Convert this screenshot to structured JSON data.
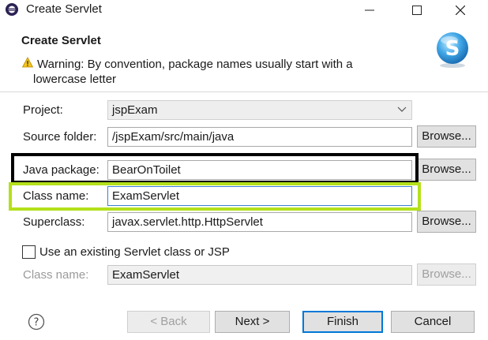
{
  "window": {
    "title": "Create Servlet"
  },
  "banner": {
    "title": "Create Servlet",
    "warning_line1": "Warning: By convention, package names usually start with a",
    "warning_line2": "lowercase letter"
  },
  "form": {
    "project": {
      "label": "Project:",
      "value": "jspExam"
    },
    "source_folder": {
      "label": "Source folder:",
      "value": "/jspExam/src/main/java",
      "browse": "Browse..."
    },
    "java_package": {
      "label": "Java package:",
      "value": "BearOnToilet",
      "browse": "Browse..."
    },
    "class_name": {
      "label": "Class name:",
      "value": "ExamServlet"
    },
    "superclass": {
      "label": "Superclass:",
      "value": "javax.servlet.http.HttpServlet",
      "browse": "Browse..."
    },
    "existing": {
      "label": "Use an existing Servlet class or JSP",
      "checked": false
    },
    "existing_class_name": {
      "label": "Class name:",
      "value": "ExamServlet",
      "browse": "Browse..."
    }
  },
  "buttons": {
    "back": "< Back",
    "next": "Next >",
    "finish": "Finish",
    "cancel": "Cancel"
  },
  "colors": {
    "highlight_black": "#000000",
    "highlight_green": "#b4e01c",
    "default_button_border": "#0078d7"
  }
}
